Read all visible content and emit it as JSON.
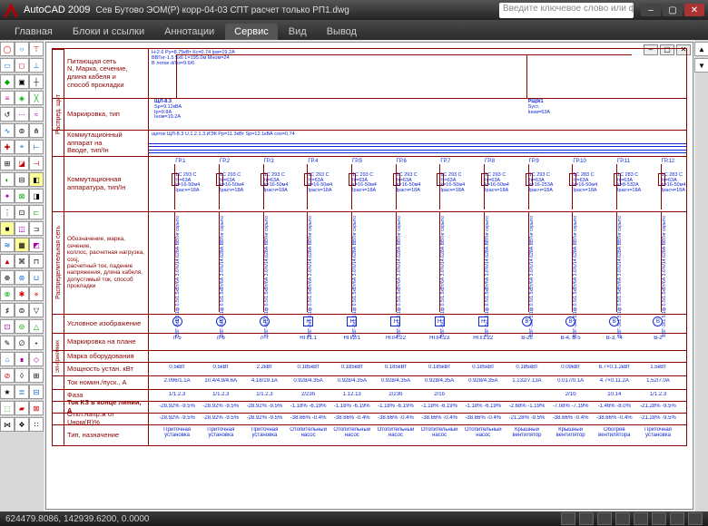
{
  "app": {
    "title": "AutoCAD 2009",
    "document": "Сев Бутово ЭОМ(Р) корр-04-03 СПТ расчет только РП1.dwg",
    "search_placeholder": "Введите ключевое слово или фразу"
  },
  "tabs": [
    "Главная",
    "Блоки и ссылки",
    "Аннотации",
    "Сервис",
    "Вид",
    "Вывод"
  ],
  "tabs_active": 3,
  "status": {
    "coords": "624479.8086, 142939.6200, 0.0000"
  },
  "side_groups": [
    "Распред. щит",
    "Распределительная сеть",
    "Эл-приёмник"
  ],
  "header_rows": {
    "feed_net": "Питающая сеть\nN, Марка, сечение,\nдлина кабеля и\nспособ прокладки",
    "marking_type": "Маркировка, тип",
    "switch_in": "Коммутационный\nаппарат на\nВводе, тип/Iн",
    "switch_app": "Коммутационная\nаппаратура, тип/Iн",
    "distro_label": "Обозначение, марка, сечение,\nколлос, расчетная нагрузка, cosj,\nрасчетный ток, падение\nнапряжения, длина кабеля,\nдопустимый ток, способ\nпрокладки",
    "symbol_img": "Условное изображение",
    "plan_mark": "Маркировка на плане",
    "equip_brand": "Марка оборудования",
    "power_inst": "Мощность устан. кВт",
    "current_nom": "Ток номин./пуск., A",
    "phase": "Фаза",
    "sc_current": "Ток КЗ в конце линии, A",
    "volt_dev": "Откл.напр.ж от Uном(R)%",
    "type_purpose": "Тип, назначение"
  },
  "top_blue_notes": [
    "Н-2.6  Ру=8.75кВт Кс=0.74 Iрв=19.2А",
    "ВВГнг-1.5 5х6  L=195.0м  Мном=24",
    "В лотке d/lкз=9.6/6"
  ],
  "panel_block_left": {
    "name": "ЩЛ-8.3",
    "lines": [
      "Sp=9.12кВА",
      "Iр=9.8А",
      "Iном=19.2А"
    ]
  },
  "panel_block_right": {
    "name": "РЩ9/1",
    "lines": [
      "Sуст.",
      "Iном=63А"
    ]
  },
  "switch_in_text": "щиток ЩЛ-8.3 U.1.2.1.3.ИЭК Pp=11.3кВт Sp=12.1кВА cos=0.74",
  "feeders": [
    {
      "tag": "ГР.1",
      "b": "1С 293 С",
      "i": "Iт=63А",
      "k": "k=16-50м4",
      "ip": "Iрасч=18А"
    },
    {
      "tag": "ГР.2",
      "b": "1С 293 С",
      "i": "Iт=63А",
      "k": "k=16-50м4",
      "ip": "Iрасч=18А"
    },
    {
      "tag": "ГР.3",
      "b": "1С 293 С",
      "i": "Iт=63А",
      "k": "k=16-50м4",
      "ip": "Iрасч=18А"
    },
    {
      "tag": "ГР.4",
      "b": "1С 293 С",
      "i": "Iт=63А",
      "k": "k=16-50м4",
      "ip": "Iрасч=18А"
    },
    {
      "tag": "ГР.5",
      "b": "1С 293 С",
      "i": "Iт=63А",
      "k": "k=16-50м4",
      "ip": "Iрасч=18А"
    },
    {
      "tag": "ГР.6",
      "b": "1С 293 С",
      "i": "Iт=63А",
      "k": "k=16-50м4",
      "ip": "Iрасч=18А"
    },
    {
      "tag": "ГР.7",
      "b": "1С 293 С",
      "i": "Iт=63А",
      "k": "k=16-50м4",
      "ip": "Iрасч=18А"
    },
    {
      "tag": "ГР.8",
      "b": "1С 293 С",
      "i": "Iт=63А",
      "k": "k=16-50м4",
      "ip": "Iрасч=18А"
    },
    {
      "tag": "ГР.9",
      "b": "1С 293 С",
      "i": "Iт=63А",
      "k": "k=16-253А",
      "ip": "Iрасч=18А"
    },
    {
      "tag": "ГР.10",
      "b": "1С 283 С",
      "i": "Iт=63А",
      "k": "k=16-50м4",
      "ip": "Iрасч=18А"
    },
    {
      "tag": "ГР.11",
      "b": "1С 283 С",
      "i": "Iт=63А",
      "k": "k=8-532А",
      "ip": "Iрасч=18А"
    },
    {
      "tag": "ГР.12",
      "b": "1С 283 С",
      "i": "Iт=63А",
      "k": "k=16-50м4",
      "ip": "Iрасч=18А"
    }
  ],
  "cable_info": "ВВГ-3х1.5\n1ф 0.5/1.5кВт/6А\n3.6%/14.628А\nВВГнг скрыто",
  "symbols": [
    "В",
    "В",
    "В",
    "Н",
    "Н",
    "Н",
    "Н",
    "Н",
    "В",
    "В",
    "В",
    "В"
  ],
  "plan_marks": [
    "Л-5",
    "Л-6",
    "Л-7",
    "НП/1.1",
    "НП/2/1",
    "НП/4.22",
    "НП/4.23",
    "НП/1.22",
    "В-2с",
    "В-4, В-5",
    "В-3, -4",
    "В-2"
  ],
  "rows": {
    "power": [
      "0.5кВт",
      "0.5кВт",
      "2.2кВт",
      "0.185кВт",
      "0.185кВт",
      "0.185кВт",
      "0.185кВт",
      "0.185кВт",
      "0.185кВт",
      "0.09кВт",
      "6.7×0.1.2кВт",
      "1.5кВт"
    ],
    "current": [
      "2.096/1.1А",
      "10.4/4.9/4.6А",
      "4.18/19.1А",
      "0.928/4.35А",
      "0.928/4.35А",
      "0.928/4.35А",
      "0.928/4.35А",
      "0.928/4.35А",
      "1.132/7.13А",
      "0.017/0.1А",
      "4.7×0.11.2А",
      "1.52/7.0А"
    ],
    "phase": [
      "1/1.2.3",
      "1/1.2.3",
      "1/1.2.3",
      "2/23б",
      "1.12.13",
      "2/23б",
      "2/1б",
      "",
      "",
      "2/1б",
      "10.14",
      "1/1.2.3"
    ],
    "sc": [
      "-28.92% -9.5%",
      "-28.92% -9.5%",
      "-28.92% -9.5%",
      "-1.18% -6.19%",
      "-1.18% -6.19%",
      "-1.18% -6.19%",
      "-1.18% -6.19%",
      "-1.18% -6.19%",
      "-2.68% -1.19%",
      "-7.08% -7.19%",
      "-1.46% -8.0%",
      "-21.28% -9.5%"
    ],
    "volt": [
      "-28.92% -9.5%",
      "-28.92% -9.5%",
      "-28.92% -9.5%",
      "-38.66% -0.4%",
      "-38.66% -0.4%",
      "-38.66% -0.4%",
      "-38.66% -0.4%",
      "-38.66% -0.4%",
      "-21.28% -9.5%",
      "-38.66% -0.4%",
      "-38.66% -0.4%",
      "-21.28% -9.5%"
    ],
    "purpose": [
      "Приточная\nустановка",
      "Приточная\nустановка",
      "Приточная\nустановка",
      "Отопительный\nнасос",
      "Отопительный\nнасос",
      "Отопительный\nнасос",
      "Отопительный\nнасос",
      "Отопительный\nнасос",
      "Крышный\nвентилятор",
      "Крышный\nвентилятор",
      "Обогрев\nвентилятора",
      "Приточная\nустановка"
    ]
  }
}
